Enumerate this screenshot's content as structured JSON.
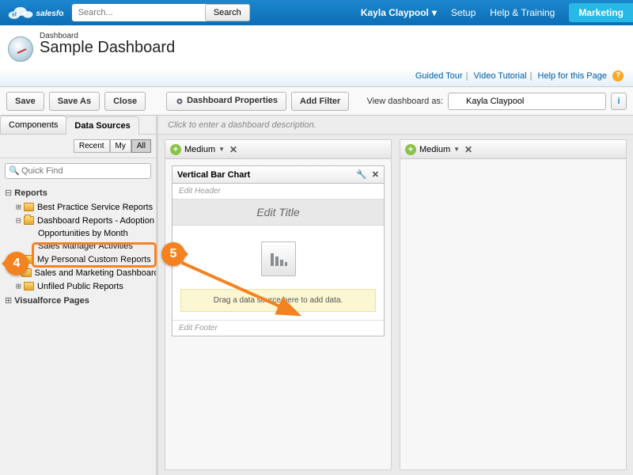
{
  "topbar": {
    "search_placeholder": "Search...",
    "search_btn": "Search",
    "user": "Kayla Claypool",
    "links": {
      "setup": "Setup",
      "help": "Help & Training"
    },
    "app": "Marketing"
  },
  "header": {
    "crumb": "Dashboard",
    "title": "Sample Dashboard",
    "help": {
      "tour": "Guided Tour",
      "video": "Video Tutorial",
      "page": "Help for this Page"
    }
  },
  "toolbar": {
    "save": "Save",
    "saveas": "Save As",
    "close": "Close",
    "props": "Dashboard Properties",
    "filter": "Add Filter",
    "viewas_label": "View dashboard as:",
    "viewas_value": "Kayla Claypool"
  },
  "sidebar": {
    "tabs": {
      "components": "Components",
      "datasources": "Data Sources"
    },
    "filters": {
      "recent": "Recent",
      "my": "My",
      "all": "All"
    },
    "quickfind": "Quick Find",
    "reports_label": "Reports",
    "nodes": [
      {
        "label": "Best Practice Service Reports"
      },
      {
        "label": "Dashboard Reports - Adoption",
        "open": true,
        "children": [
          {
            "label": "Opportunities by Month"
          },
          {
            "label": "Sales Manager Activities"
          }
        ]
      },
      {
        "label": "My Personal Custom Reports"
      },
      {
        "label": "Sales and Marketing Dashboards"
      },
      {
        "label": "Unfiled Public Reports"
      }
    ],
    "vf_label": "Visualforce Pages"
  },
  "canvas": {
    "desc_placeholder": "Click to enter a dashboard description.",
    "col_size": "Medium",
    "component": {
      "type_label": "Vertical Bar Chart",
      "edit_header": "Edit Header",
      "edit_title": "Edit Title",
      "drop_hint": "Drag a data source here to add data.",
      "edit_footer": "Edit Footer"
    }
  },
  "steps": {
    "s4": "4",
    "s5": "5"
  }
}
